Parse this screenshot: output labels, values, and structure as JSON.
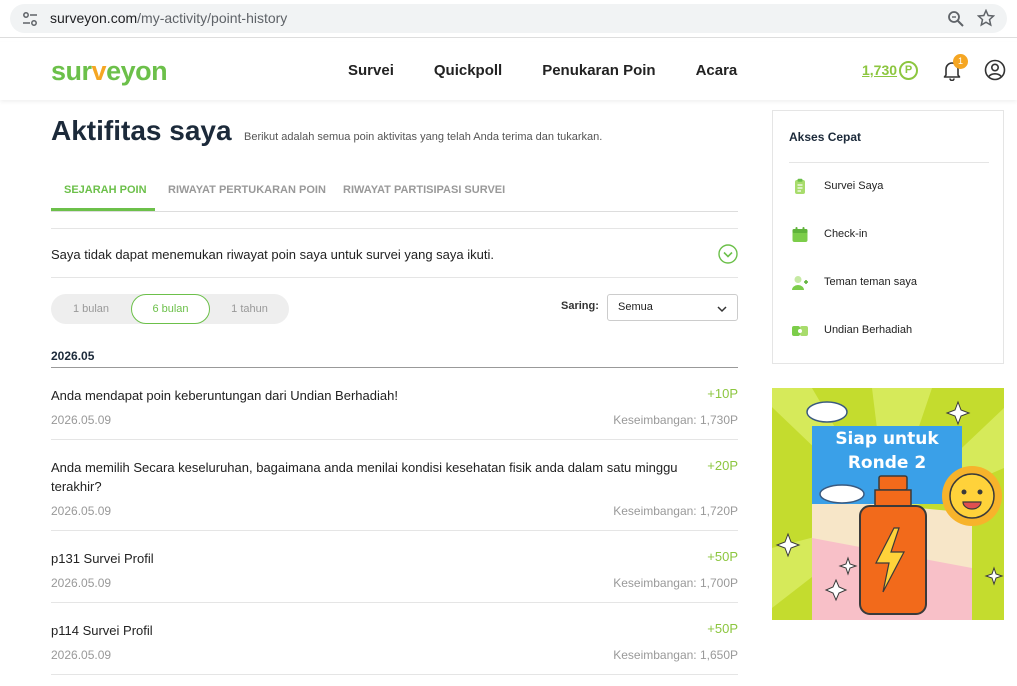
{
  "browser": {
    "url_domain": "surveyon.com",
    "url_path": "/my-activity/point-history"
  },
  "header": {
    "logo_part1": "sur",
    "logo_part2": "v",
    "logo_part3": "eyon",
    "nav": [
      "Survei",
      "Quickpoll",
      "Penukaran Poin",
      "Acara"
    ],
    "points": "1,730",
    "points_symbol": "P",
    "notifications": "1"
  },
  "page": {
    "title": "Aktifitas saya",
    "description": "Berikut adalah semua poin aktivitas yang telah Anda terima dan tukarkan."
  },
  "tabs": [
    "SEJARAH POIN",
    "RIWAYAT PERTUKARAN POIN",
    "RIWAYAT PARTISIPASI SURVEI"
  ],
  "faq": {
    "text": "Saya tidak dapat menemukan riwayat poin saya untuk survei yang saya ikuti."
  },
  "periods": [
    "1 bulan",
    "6 bulan",
    "1 tahun"
  ],
  "filter": {
    "label": "Saring:",
    "value": "Semua"
  },
  "month": "2026.05",
  "entries": [
    {
      "title": "Anda mendapat poin keberuntungan dari Undian Berhadiah!",
      "points": "+10P",
      "date": "2026.05.09",
      "balance": "Keseimbangan: 1,730P"
    },
    {
      "title": "Anda memilih Secara keseluruhan, bagaimana anda menilai kondisi kesehatan fisik anda dalam satu minggu terakhir?",
      "points": "+20P",
      "date": "2026.05.09",
      "balance": "Keseimbangan: 1,720P"
    },
    {
      "title": "p131 Survei Profil",
      "points": "+50P",
      "date": "2026.05.09",
      "balance": "Keseimbangan: 1,700P"
    },
    {
      "title": "p114 Survei Profil",
      "points": "+50P",
      "date": "2026.05.09",
      "balance": "Keseimbangan: 1,650P"
    }
  ],
  "quick_access": {
    "title": "Akses Cepat",
    "items": [
      "Survei Saya",
      "Check-in",
      "Teman teman saya",
      "Undian Berhadiah"
    ]
  },
  "banner": {
    "line1": "Siap untuk",
    "line2": "Ronde 2"
  },
  "colors": {
    "brand_green": "#6cc04a",
    "points_green": "#8cc63f",
    "accent_orange": "#f5a623"
  }
}
